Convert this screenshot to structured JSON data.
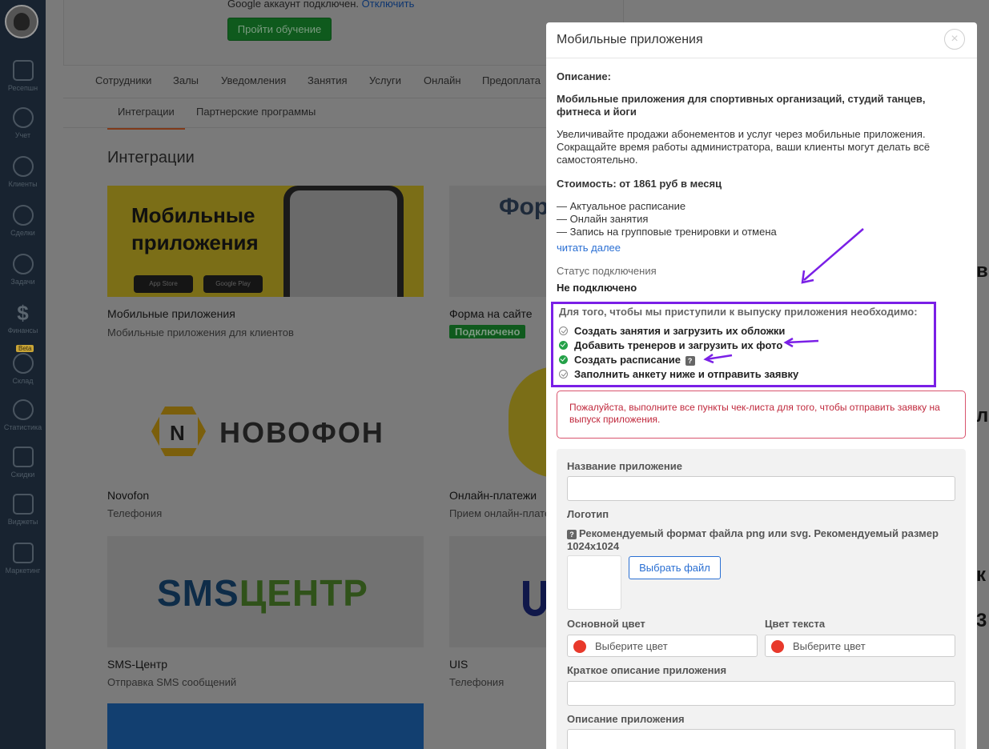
{
  "sidebar": {
    "items": [
      {
        "label": "Ресепшн",
        "icon": "home-icon"
      },
      {
        "label": "Учет",
        "icon": "calendar-icon"
      },
      {
        "label": "Клиенты",
        "icon": "clients-icon"
      },
      {
        "label": "Сделки",
        "icon": "handshake-icon"
      },
      {
        "label": "Задачи",
        "icon": "tasks-icon"
      },
      {
        "label": "Финансы",
        "icon": "dollar-icon"
      },
      {
        "label": "Склад",
        "icon": "warehouse-icon",
        "badge": "Beta"
      },
      {
        "label": "Статистика",
        "icon": "stats-icon"
      },
      {
        "label": "Скидки",
        "icon": "discount-icon"
      },
      {
        "label": "Виджеты",
        "icon": "widgets-icon"
      },
      {
        "label": "Маркетинг",
        "icon": "marketing-icon"
      }
    ]
  },
  "top": {
    "google_text": "Google аккаунт подключен.",
    "google_link": "Отключить",
    "train_button": "Пройти обучение"
  },
  "tabs": [
    "Сотрудники",
    "Залы",
    "Уведомления",
    "Занятия",
    "Услуги",
    "Онлайн",
    "Предоплата"
  ],
  "subtabs": [
    "Интеграции",
    "Партнерские программы"
  ],
  "page_title": "Интеграции",
  "cards": [
    {
      "title": "Мобильные приложения",
      "subtitle": "Мобильные приложения для клиентов",
      "banner_line1": "Мобильные",
      "banner_line2": "приложения",
      "store1": "App Store",
      "store2": "Google Play"
    },
    {
      "title": "Форма на сайте",
      "badge": "Подключено",
      "banner": "Фор"
    },
    {
      "title": "Novofon",
      "subtitle": "Телефония",
      "logo_letter": "N",
      "logo_text": "НОВОФОН"
    },
    {
      "title": "Онлайн-платежи",
      "subtitle": "Прием онлайн-плате"
    },
    {
      "title": "SMS-Центр",
      "subtitle": "Отправка SMS сообщений",
      "logo_a": "SMS",
      "logo_b": "ЦЕНТР"
    },
    {
      "title": "UIS",
      "subtitle": "Телефония"
    }
  ],
  "modal": {
    "title": "Мобильные приложения",
    "close_label": "×",
    "description_label": "Описание:",
    "headline": "Мобильные приложения для спортивных организаций, студий танцев, фитнеса и йоги",
    "description": "Увеличивайте продажи абонементов и услуг через мобильные приложения. Сокращайте время работы администратора, ваши клиенты могут делать всё самостоятельно.",
    "price": "Стоимость: от 1861 руб в месяц",
    "features": [
      "— Актуальное расписание",
      "— Онлайн занятия",
      "— Запись на групповые тренировки и отмена"
    ],
    "read_more": "читать далее",
    "status_label": "Статус подключения",
    "status_value": "Не подключено",
    "checklist": {
      "heading": "Для того, чтобы мы приступили к выпуску приложения необходимо:",
      "items": [
        {
          "label": "Создать занятия и загрузить их обложки",
          "done": false
        },
        {
          "label": "Добавить тренеров и загрузить их фото",
          "done": true
        },
        {
          "label": "Создать расписание",
          "done": true,
          "help": "?"
        },
        {
          "label": "Заполнить анкету ниже и отправить заявку",
          "done": false
        }
      ]
    },
    "alert": "Пожалуйста, выполните все пункты чек-листа для того, чтобы отправить заявку на выпуск приложения.",
    "form": {
      "app_name_label": "Название приложение",
      "logo_label": "Логотип",
      "logo_hint_badge": "?",
      "logo_hint": "Рекомендуемый формат файла png или svg. Рекомендуемый размер 1024x1024",
      "file_button": "Выбрать файл",
      "main_color_label": "Основной цвет",
      "text_color_label": "Цвет текста",
      "color_placeholder": "Выберите цвет",
      "color_value": "#e8392b",
      "short_desc_label": "Краткое описание приложения",
      "desc_label": "Описание приложения"
    }
  },
  "annotation_color": "#7a1fe6",
  "behind_modal_glyphs": [
    "в",
    "л",
    "к",
    "3"
  ]
}
